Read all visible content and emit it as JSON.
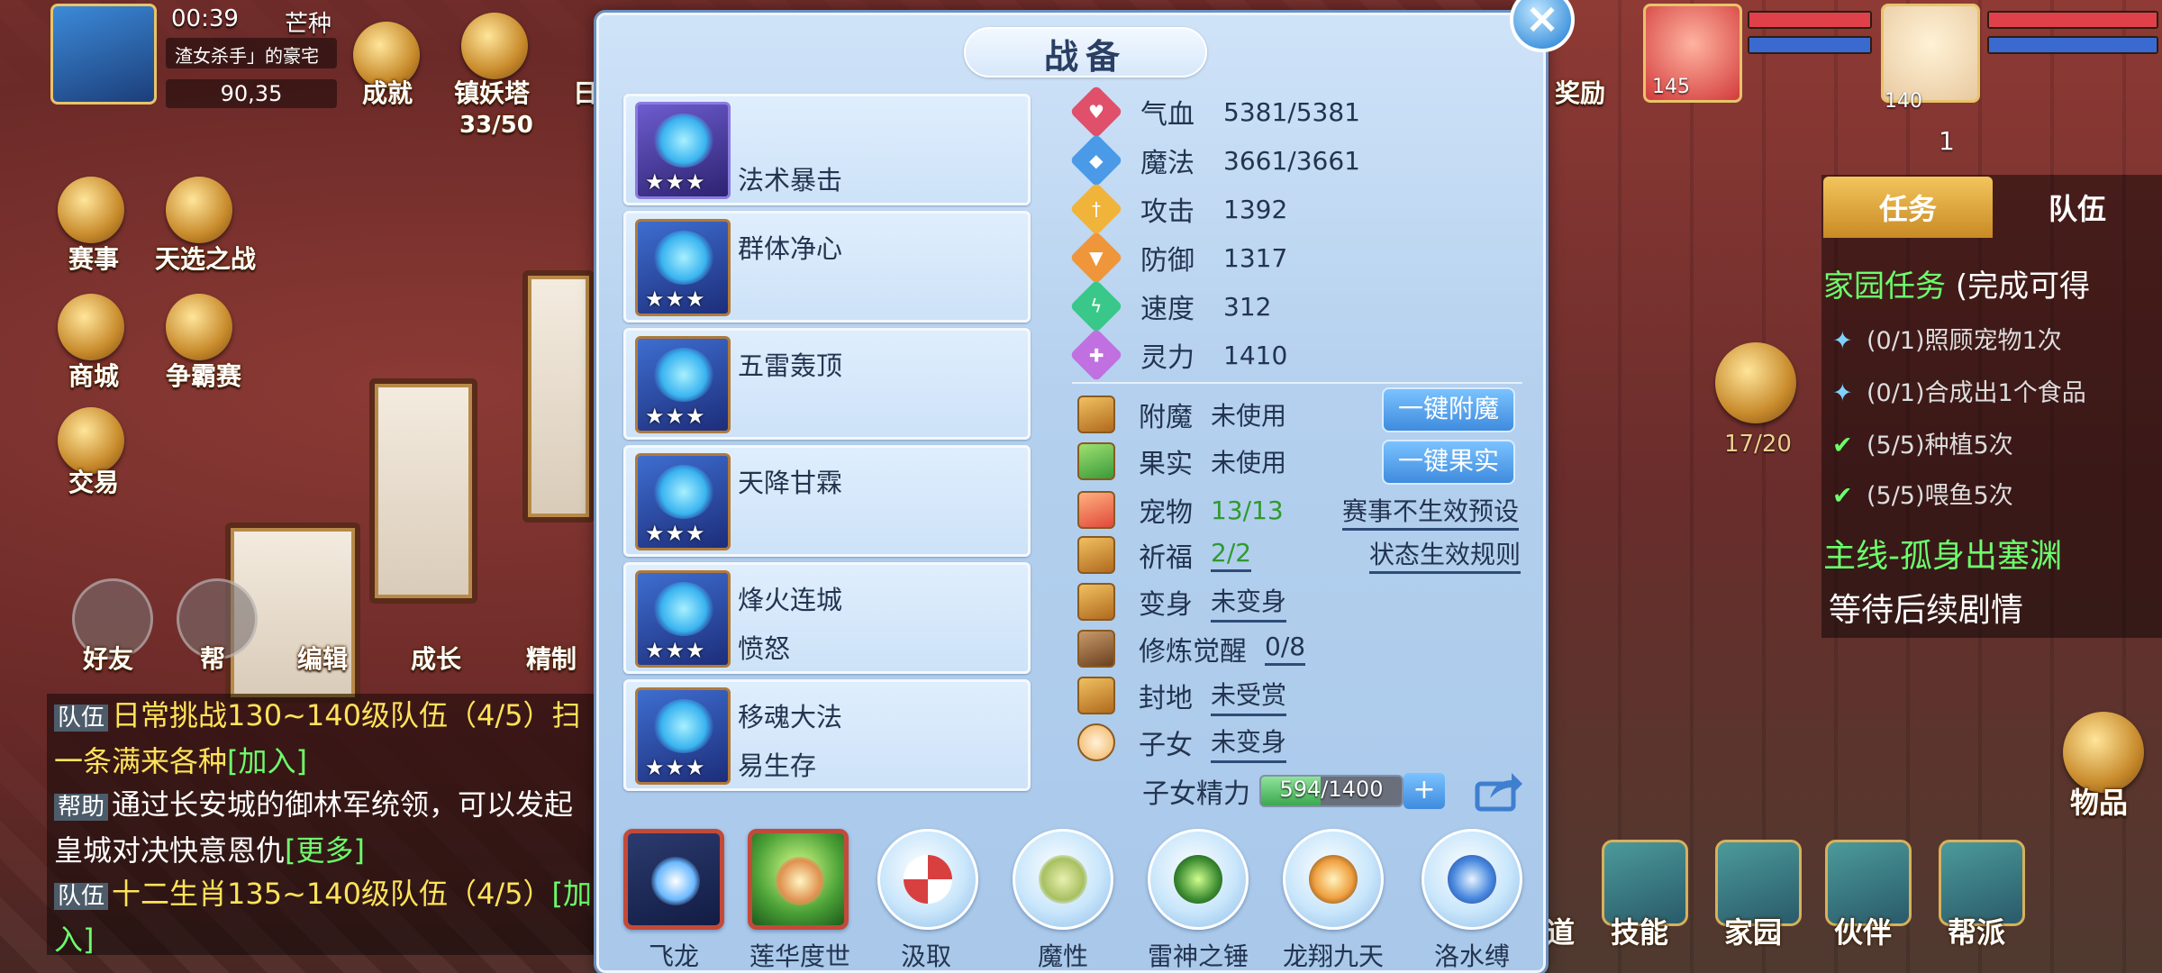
{
  "hud": {
    "time": "00:39",
    "solar_term": "芒种",
    "location": "渣女杀手」的豪宅",
    "coords": "90,35",
    "left_icons": [
      {
        "label": "成就",
        "icon": "achievement-icon"
      },
      {
        "label": "镇妖塔",
        "icon": "tower-icon"
      },
      {
        "label": "日",
        "icon": "daily-icon"
      },
      {
        "label": "赛事",
        "icon": "event-icon"
      },
      {
        "label": "天选之战",
        "icon": "battle-icon"
      },
      {
        "label": "商城",
        "icon": "shop-icon"
      },
      {
        "label": "争霸赛",
        "icon": "tournament-icon"
      },
      {
        "label": "交易",
        "icon": "trade-icon"
      }
    ],
    "tower_progress": "33/50",
    "social_buttons": [
      "好友",
      "帮",
      "编辑",
      "成长",
      "精制"
    ]
  },
  "chat": [
    {
      "tag": "队伍",
      "text": "日常挑战130~140级队伍（4/5）扫",
      "extra": "一条满来各种",
      "link": "[加入]"
    },
    {
      "tag": "帮助",
      "text": "通过长安城的御林军统领，可以发起",
      "extra": "皇城对决快意恩仇",
      "link": "[更多]"
    },
    {
      "tag": "队伍",
      "text": "十二生肖135~140级队伍（4/5）",
      "link": "[加",
      "extra": "入]"
    }
  ],
  "right_hud": {
    "reward_label": "奖励",
    "pet_level": "145",
    "char_level": "140",
    "hourglass_count": "1",
    "task_tabs": [
      "任务",
      "队伍"
    ],
    "home_task_title": "家园任务",
    "home_task_hint": "(完成可得",
    "tasks": [
      {
        "text": "(0/1)照顾宠物1次",
        "done": false
      },
      {
        "text": "(0/1)合成出1个食品",
        "done": false
      },
      {
        "text": "(5/5)种植5次",
        "done": true
      },
      {
        "text": "(5/5)喂鱼5次",
        "done": true
      }
    ],
    "pet_count": "17/20",
    "main_quest_title": "主线-孤身出塞渊",
    "main_quest_desc": "等待后续剧情",
    "items_label": "物品",
    "bottom_buttons": [
      "道",
      "技能",
      "家园",
      "伙伴",
      "帮派"
    ]
  },
  "dialog": {
    "title": "战备",
    "close_label": "×",
    "skills": [
      {
        "name": "",
        "sub": "法术暴击",
        "stars": "★★★"
      },
      {
        "name": "群体净心",
        "sub": "",
        "stars": "★★★"
      },
      {
        "name": "五雷轰顶",
        "sub": "",
        "stars": "★★★"
      },
      {
        "name": "天降甘霖",
        "sub": "",
        "stars": "★★★"
      },
      {
        "name": "烽火连城",
        "sub": "愤怒",
        "stars": "★★★"
      },
      {
        "name": "移魂大法",
        "sub": "易生存",
        "stars": "★★★"
      }
    ],
    "stats": [
      {
        "label": "气血",
        "value": "5381/5381",
        "color": "#e0506a",
        "icon": "heart-icon"
      },
      {
        "label": "魔法",
        "value": "3661/3661",
        "color": "#4a9ae8",
        "icon": "mana-icon"
      },
      {
        "label": "攻击",
        "value": "1392",
        "color": "#f0b43a",
        "icon": "sword-icon"
      },
      {
        "label": "防御",
        "value": "1317",
        "color": "#f0963a",
        "icon": "shield-icon"
      },
      {
        "label": "速度",
        "value": "312",
        "color": "#3ac88a",
        "icon": "lightning-icon"
      },
      {
        "label": "灵力",
        "value": "1410",
        "color": "#c070e0",
        "icon": "spirit-icon"
      }
    ],
    "attrs": [
      {
        "label": "附魔",
        "value": "未使用",
        "style": "plain",
        "icon": "enchant-icon"
      },
      {
        "label": "果实",
        "value": "未使用",
        "style": "plain",
        "icon": "fruit-icon"
      },
      {
        "label": "宠物",
        "value": "13/13",
        "style": "green",
        "icon": "pet-icon"
      },
      {
        "label": "祈福",
        "value": "2/2",
        "style": "green-ul",
        "icon": "blessing-icon"
      },
      {
        "label": "变身",
        "value": "未变身",
        "style": "ul",
        "icon": "transform-icon"
      },
      {
        "label": "修炼觉醒",
        "value": "0/8",
        "style": "ul",
        "icon": "cultivation-icon"
      },
      {
        "label": "封地",
        "value": "未受赏",
        "style": "ul",
        "icon": "fief-icon"
      },
      {
        "label": "子女",
        "value": "未变身",
        "style": "ul",
        "icon": "child-icon"
      }
    ],
    "buttons": {
      "enchant": "一键附魔",
      "fruit": "一键果实",
      "preset_link": "赛事不生效预设",
      "rules_link": "状态生效规则"
    },
    "child_energy": {
      "label": "子女精力",
      "current": 594,
      "max": 1400,
      "text": "594/1400",
      "plus": "+"
    },
    "bottom_skills": [
      {
        "label": "飞龙",
        "selected": true
      },
      {
        "label": "莲华度世",
        "selected": true
      },
      {
        "label": "汲取",
        "selected": false
      },
      {
        "label": "魔性",
        "selected": false
      },
      {
        "label": "雷神之锤",
        "selected": false
      },
      {
        "label": "龙翔九天",
        "selected": false
      },
      {
        "label": "洛水缚",
        "selected": false
      }
    ]
  }
}
